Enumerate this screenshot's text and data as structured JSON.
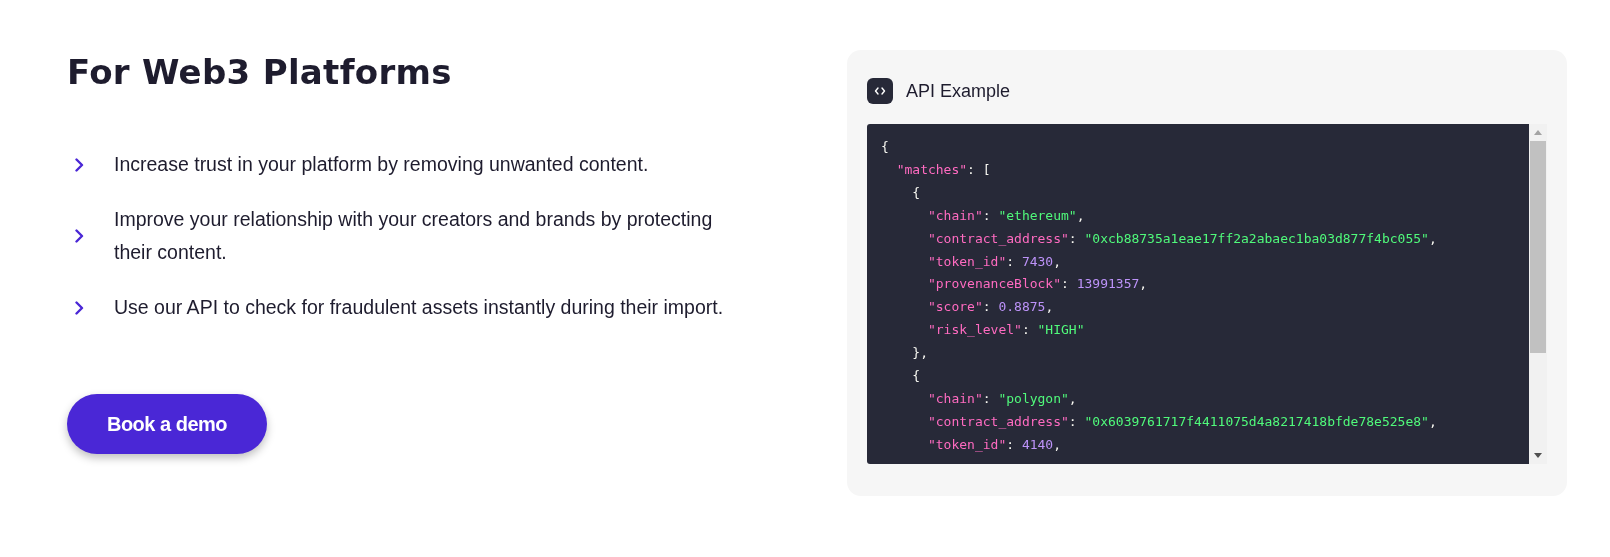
{
  "heading": "For Web3 Platforms",
  "benefits": [
    "Increase trust in your platform by removing unwanted content.",
    "Improve your relationship with your creators and brands by protecting their content.",
    "Use our API to check for fraudulent assets instantly during their import."
  ],
  "cta": {
    "label": "Book a demo"
  },
  "api_panel": {
    "title": "API Example",
    "code_lines": [
      [
        {
          "kind": "punct",
          "text": "{"
        }
      ],
      [
        {
          "kind": "key",
          "text": "  \"matches\""
        },
        {
          "kind": "punct",
          "text": ": ["
        }
      ],
      [
        {
          "kind": "punct",
          "text": "    {"
        }
      ],
      [
        {
          "kind": "key",
          "text": "      \"chain\""
        },
        {
          "kind": "punct",
          "text": ": "
        },
        {
          "kind": "string",
          "text": "\"ethereum\""
        },
        {
          "kind": "punct",
          "text": ","
        }
      ],
      [
        {
          "kind": "key",
          "text": "      \"contract_address\""
        },
        {
          "kind": "punct",
          "text": ": "
        },
        {
          "kind": "string",
          "text": "\"0xcb88735a1eae17ff2a2abaec1ba03d877f4bc055\""
        },
        {
          "kind": "punct",
          "text": ","
        }
      ],
      [
        {
          "kind": "key",
          "text": "      \"token_id\""
        },
        {
          "kind": "punct",
          "text": ": "
        },
        {
          "kind": "number",
          "text": "7430"
        },
        {
          "kind": "punct",
          "text": ","
        }
      ],
      [
        {
          "kind": "key",
          "text": "      \"provenanceBlock\""
        },
        {
          "kind": "punct",
          "text": ": "
        },
        {
          "kind": "number",
          "text": "13991357"
        },
        {
          "kind": "punct",
          "text": ","
        }
      ],
      [
        {
          "kind": "key",
          "text": "      \"score\""
        },
        {
          "kind": "punct",
          "text": ": "
        },
        {
          "kind": "number",
          "text": "0.8875"
        },
        {
          "kind": "punct",
          "text": ","
        }
      ],
      [
        {
          "kind": "key",
          "text": "      \"risk_level\""
        },
        {
          "kind": "punct",
          "text": ": "
        },
        {
          "kind": "string",
          "text": "\"HIGH\""
        }
      ],
      [
        {
          "kind": "punct",
          "text": "    },"
        }
      ],
      [
        {
          "kind": "punct",
          "text": "    {"
        }
      ],
      [
        {
          "kind": "key",
          "text": "      \"chain\""
        },
        {
          "kind": "punct",
          "text": ": "
        },
        {
          "kind": "string",
          "text": "\"polygon\""
        },
        {
          "kind": "punct",
          "text": ","
        }
      ],
      [
        {
          "kind": "key",
          "text": "      \"contract_address\""
        },
        {
          "kind": "punct",
          "text": ": "
        },
        {
          "kind": "string",
          "text": "\"0x6039761717f4411075d4a8217418bfde78e525e8\""
        },
        {
          "kind": "punct",
          "text": ","
        }
      ],
      [
        {
          "kind": "key",
          "text": "      \"token_id\""
        },
        {
          "kind": "punct",
          "text": ": "
        },
        {
          "kind": "number",
          "text": "4140"
        },
        {
          "kind": "punct",
          "text": ","
        }
      ]
    ]
  }
}
